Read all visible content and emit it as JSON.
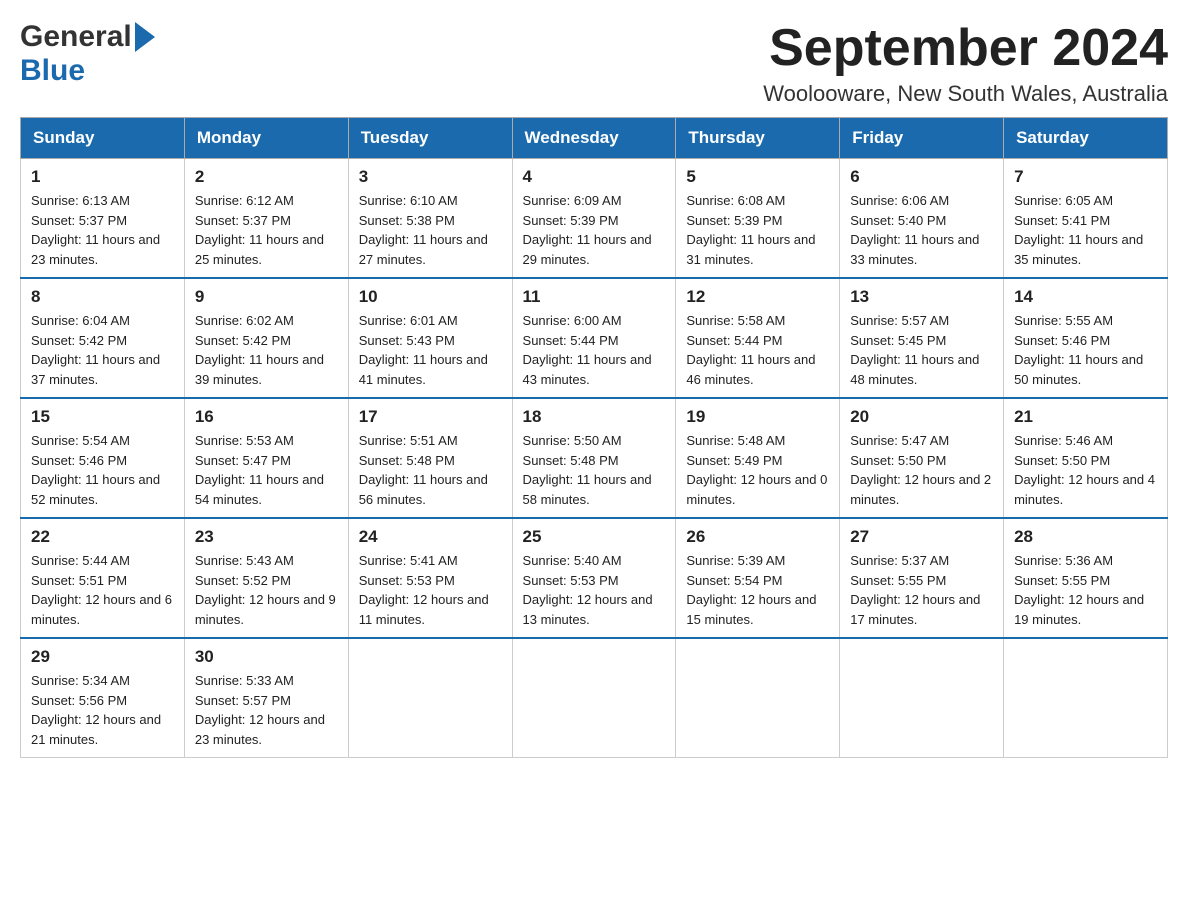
{
  "logo": {
    "general": "General",
    "blue": "Blue"
  },
  "header": {
    "month_year": "September 2024",
    "location": "Woolooware, New South Wales, Australia"
  },
  "weekdays": [
    "Sunday",
    "Monday",
    "Tuesday",
    "Wednesday",
    "Thursday",
    "Friday",
    "Saturday"
  ],
  "weeks": [
    [
      {
        "day": "1",
        "sunrise": "6:13 AM",
        "sunset": "5:37 PM",
        "daylight": "11 hours and 23 minutes."
      },
      {
        "day": "2",
        "sunrise": "6:12 AM",
        "sunset": "5:37 PM",
        "daylight": "11 hours and 25 minutes."
      },
      {
        "day": "3",
        "sunrise": "6:10 AM",
        "sunset": "5:38 PM",
        "daylight": "11 hours and 27 minutes."
      },
      {
        "day": "4",
        "sunrise": "6:09 AM",
        "sunset": "5:39 PM",
        "daylight": "11 hours and 29 minutes."
      },
      {
        "day": "5",
        "sunrise": "6:08 AM",
        "sunset": "5:39 PM",
        "daylight": "11 hours and 31 minutes."
      },
      {
        "day": "6",
        "sunrise": "6:06 AM",
        "sunset": "5:40 PM",
        "daylight": "11 hours and 33 minutes."
      },
      {
        "day": "7",
        "sunrise": "6:05 AM",
        "sunset": "5:41 PM",
        "daylight": "11 hours and 35 minutes."
      }
    ],
    [
      {
        "day": "8",
        "sunrise": "6:04 AM",
        "sunset": "5:42 PM",
        "daylight": "11 hours and 37 minutes."
      },
      {
        "day": "9",
        "sunrise": "6:02 AM",
        "sunset": "5:42 PM",
        "daylight": "11 hours and 39 minutes."
      },
      {
        "day": "10",
        "sunrise": "6:01 AM",
        "sunset": "5:43 PM",
        "daylight": "11 hours and 41 minutes."
      },
      {
        "day": "11",
        "sunrise": "6:00 AM",
        "sunset": "5:44 PM",
        "daylight": "11 hours and 43 minutes."
      },
      {
        "day": "12",
        "sunrise": "5:58 AM",
        "sunset": "5:44 PM",
        "daylight": "11 hours and 46 minutes."
      },
      {
        "day": "13",
        "sunrise": "5:57 AM",
        "sunset": "5:45 PM",
        "daylight": "11 hours and 48 minutes."
      },
      {
        "day": "14",
        "sunrise": "5:55 AM",
        "sunset": "5:46 PM",
        "daylight": "11 hours and 50 minutes."
      }
    ],
    [
      {
        "day": "15",
        "sunrise": "5:54 AM",
        "sunset": "5:46 PM",
        "daylight": "11 hours and 52 minutes."
      },
      {
        "day": "16",
        "sunrise": "5:53 AM",
        "sunset": "5:47 PM",
        "daylight": "11 hours and 54 minutes."
      },
      {
        "day": "17",
        "sunrise": "5:51 AM",
        "sunset": "5:48 PM",
        "daylight": "11 hours and 56 minutes."
      },
      {
        "day": "18",
        "sunrise": "5:50 AM",
        "sunset": "5:48 PM",
        "daylight": "11 hours and 58 minutes."
      },
      {
        "day": "19",
        "sunrise": "5:48 AM",
        "sunset": "5:49 PM",
        "daylight": "12 hours and 0 minutes."
      },
      {
        "day": "20",
        "sunrise": "5:47 AM",
        "sunset": "5:50 PM",
        "daylight": "12 hours and 2 minutes."
      },
      {
        "day": "21",
        "sunrise": "5:46 AM",
        "sunset": "5:50 PM",
        "daylight": "12 hours and 4 minutes."
      }
    ],
    [
      {
        "day": "22",
        "sunrise": "5:44 AM",
        "sunset": "5:51 PM",
        "daylight": "12 hours and 6 minutes."
      },
      {
        "day": "23",
        "sunrise": "5:43 AM",
        "sunset": "5:52 PM",
        "daylight": "12 hours and 9 minutes."
      },
      {
        "day": "24",
        "sunrise": "5:41 AM",
        "sunset": "5:53 PM",
        "daylight": "12 hours and 11 minutes."
      },
      {
        "day": "25",
        "sunrise": "5:40 AM",
        "sunset": "5:53 PM",
        "daylight": "12 hours and 13 minutes."
      },
      {
        "day": "26",
        "sunrise": "5:39 AM",
        "sunset": "5:54 PM",
        "daylight": "12 hours and 15 minutes."
      },
      {
        "day": "27",
        "sunrise": "5:37 AM",
        "sunset": "5:55 PM",
        "daylight": "12 hours and 17 minutes."
      },
      {
        "day": "28",
        "sunrise": "5:36 AM",
        "sunset": "5:55 PM",
        "daylight": "12 hours and 19 minutes."
      }
    ],
    [
      {
        "day": "29",
        "sunrise": "5:34 AM",
        "sunset": "5:56 PM",
        "daylight": "12 hours and 21 minutes."
      },
      {
        "day": "30",
        "sunrise": "5:33 AM",
        "sunset": "5:57 PM",
        "daylight": "12 hours and 23 minutes."
      },
      null,
      null,
      null,
      null,
      null
    ]
  ]
}
